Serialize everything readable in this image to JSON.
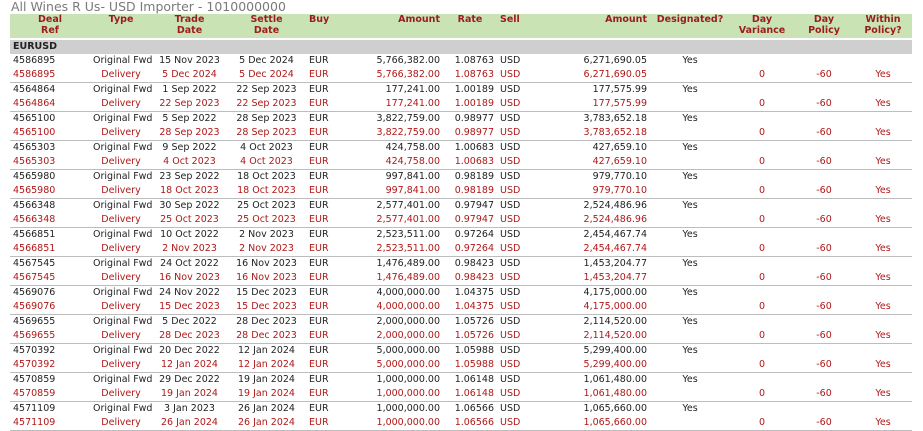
{
  "title": "All Wines R Us- USD Importer - 1010000000",
  "columns": {
    "deal_ref": [
      "Deal",
      "Ref"
    ],
    "type": [
      "Type",
      ""
    ],
    "trade_date": [
      "Trade",
      "Date"
    ],
    "settle_date": [
      "Settle",
      "Date"
    ],
    "buy": [
      "Buy",
      ""
    ],
    "amount_buy": [
      "Amount",
      ""
    ],
    "rate": [
      "Rate",
      ""
    ],
    "sell": [
      "Sell",
      ""
    ],
    "amount_sell": [
      "Amount",
      ""
    ],
    "designated": [
      "Designated?",
      ""
    ],
    "day_variance": [
      "Day",
      "Variance"
    ],
    "day_policy": [
      "Day",
      "Policy"
    ],
    "within_policy": [
      "Within",
      "Policy?"
    ]
  },
  "group": "EURUSD",
  "deals": [
    {
      "ref": "4586895",
      "orig_type": "Original Fwd",
      "deliv_type": "Delivery",
      "trade": "15 Nov 2023",
      "settle": "5 Dec 2024",
      "deliv_trade": "5 Dec 2024",
      "deliv_settle": "5 Dec 2024",
      "buy": "EUR",
      "amount": "5,766,382.00",
      "rate": "1.08763",
      "sell": "USD",
      "amount2": "6,271,690.05",
      "designated": "Yes",
      "variance": "0",
      "policy": "-60",
      "within": "Yes"
    },
    {
      "ref": "4564864",
      "orig_type": "Original Fwd",
      "deliv_type": "Delivery",
      "trade": "1 Sep 2022",
      "settle": "22 Sep 2023",
      "deliv_trade": "22 Sep 2023",
      "deliv_settle": "22 Sep 2023",
      "buy": "EUR",
      "amount": "177,241.00",
      "rate": "1.00189",
      "sell": "USD",
      "amount2": "177,575.99",
      "designated": "Yes",
      "variance": "0",
      "policy": "-60",
      "within": "Yes"
    },
    {
      "ref": "4565100",
      "orig_type": "Original Fwd",
      "deliv_type": "Delivery",
      "trade": "5 Sep 2022",
      "settle": "28 Sep 2023",
      "deliv_trade": "28 Sep 2023",
      "deliv_settle": "28 Sep 2023",
      "buy": "EUR",
      "amount": "3,822,759.00",
      "rate": "0.98977",
      "sell": "USD",
      "amount2": "3,783,652.18",
      "designated": "Yes",
      "variance": "0",
      "policy": "-60",
      "within": "Yes"
    },
    {
      "ref": "4565303",
      "orig_type": "Original Fwd",
      "deliv_type": "Delivery",
      "trade": "9 Sep 2022",
      "settle": "4 Oct 2023",
      "deliv_trade": "4 Oct 2023",
      "deliv_settle": "4 Oct 2023",
      "buy": "EUR",
      "amount": "424,758.00",
      "rate": "1.00683",
      "sell": "USD",
      "amount2": "427,659.10",
      "designated": "Yes",
      "variance": "0",
      "policy": "-60",
      "within": "Yes"
    },
    {
      "ref": "4565980",
      "orig_type": "Original Fwd",
      "deliv_type": "Delivery",
      "trade": "23 Sep 2022",
      "settle": "18 Oct 2023",
      "deliv_trade": "18 Oct 2023",
      "deliv_settle": "18 Oct 2023",
      "buy": "EUR",
      "amount": "997,841.00",
      "rate": "0.98189",
      "sell": "USD",
      "amount2": "979,770.10",
      "designated": "Yes",
      "variance": "0",
      "policy": "-60",
      "within": "Yes"
    },
    {
      "ref": "4566348",
      "orig_type": "Original Fwd",
      "deliv_type": "Delivery",
      "trade": "30 Sep 2022",
      "settle": "25 Oct 2023",
      "deliv_trade": "25 Oct 2023",
      "deliv_settle": "25 Oct 2023",
      "buy": "EUR",
      "amount": "2,577,401.00",
      "rate": "0.97947",
      "sell": "USD",
      "amount2": "2,524,486.96",
      "designated": "Yes",
      "variance": "0",
      "policy": "-60",
      "within": "Yes"
    },
    {
      "ref": "4566851",
      "orig_type": "Original Fwd",
      "deliv_type": "Delivery",
      "trade": "10 Oct 2022",
      "settle": "2 Nov 2023",
      "deliv_trade": "2 Nov 2023",
      "deliv_settle": "2 Nov 2023",
      "buy": "EUR",
      "amount": "2,523,511.00",
      "rate": "0.97264",
      "sell": "USD",
      "amount2": "2,454,467.74",
      "designated": "Yes",
      "variance": "0",
      "policy": "-60",
      "within": "Yes"
    },
    {
      "ref": "4567545",
      "orig_type": "Original Fwd",
      "deliv_type": "Delivery",
      "trade": "24 Oct 2022",
      "settle": "16 Nov 2023",
      "deliv_trade": "16 Nov 2023",
      "deliv_settle": "16 Nov 2023",
      "buy": "EUR",
      "amount": "1,476,489.00",
      "rate": "0.98423",
      "sell": "USD",
      "amount2": "1,453,204.77",
      "designated": "Yes",
      "variance": "0",
      "policy": "-60",
      "within": "Yes"
    },
    {
      "ref": "4569076",
      "orig_type": "Original Fwd",
      "deliv_type": "Delivery",
      "trade": "24 Nov 2022",
      "settle": "15 Dec 2023",
      "deliv_trade": "15 Dec 2023",
      "deliv_settle": "15 Dec 2023",
      "buy": "EUR",
      "amount": "4,000,000.00",
      "rate": "1.04375",
      "sell": "USD",
      "amount2": "4,175,000.00",
      "designated": "Yes",
      "variance": "0",
      "policy": "-60",
      "within": "Yes"
    },
    {
      "ref": "4569655",
      "orig_type": "Original Fwd",
      "deliv_type": "Delivery",
      "trade": "5 Dec 2022",
      "settle": "28 Dec 2023",
      "deliv_trade": "28 Dec 2023",
      "deliv_settle": "28 Dec 2023",
      "buy": "EUR",
      "amount": "2,000,000.00",
      "rate": "1.05726",
      "sell": "USD",
      "amount2": "2,114,520.00",
      "designated": "Yes",
      "variance": "0",
      "policy": "-60",
      "within": "Yes"
    },
    {
      "ref": "4570392",
      "orig_type": "Original Fwd",
      "deliv_type": "Delivery",
      "trade": "20 Dec 2022",
      "settle": "12 Jan 2024",
      "deliv_trade": "12 Jan 2024",
      "deliv_settle": "12 Jan 2024",
      "buy": "EUR",
      "amount": "5,000,000.00",
      "rate": "1.05988",
      "sell": "USD",
      "amount2": "5,299,400.00",
      "designated": "Yes",
      "variance": "0",
      "policy": "-60",
      "within": "Yes"
    },
    {
      "ref": "4570859",
      "orig_type": "Original Fwd",
      "deliv_type": "Delivery",
      "trade": "29 Dec 2022",
      "settle": "19 Jan 2024",
      "deliv_trade": "19 Jan 2024",
      "deliv_settle": "19 Jan 2024",
      "buy": "EUR",
      "amount": "1,000,000.00",
      "rate": "1.06148",
      "sell": "USD",
      "amount2": "1,061,480.00",
      "designated": "Yes",
      "variance": "0",
      "policy": "-60",
      "within": "Yes"
    },
    {
      "ref": "4571109",
      "orig_type": "Original Fwd",
      "deliv_type": "Delivery",
      "trade": "3 Jan 2023",
      "settle": "26 Jan 2024",
      "deliv_trade": "26 Jan 2024",
      "deliv_settle": "26 Jan 2024",
      "buy": "EUR",
      "amount": "1,000,000.00",
      "rate": "1.06566",
      "sell": "USD",
      "amount2": "1,065,660.00",
      "designated": "Yes",
      "variance": "0",
      "policy": "-60",
      "within": "Yes"
    }
  ]
}
